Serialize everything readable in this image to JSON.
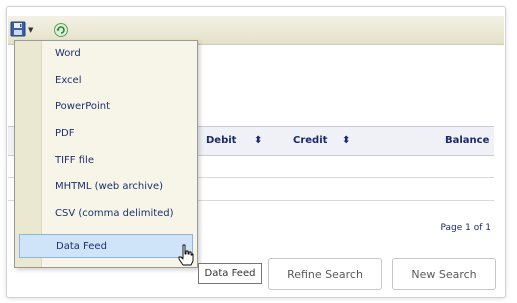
{
  "toolbar": {
    "export_icon": "save-disk-icon",
    "dropdown_icon": "chevron-down-icon",
    "refresh_icon": "refresh-icon"
  },
  "export_menu": {
    "items": [
      {
        "label": "Word"
      },
      {
        "label": "Excel"
      },
      {
        "label": "PowerPoint"
      },
      {
        "label": "PDF"
      },
      {
        "label": "TIFF file"
      },
      {
        "label": "MHTML (web archive)"
      },
      {
        "label": "CSV (comma delimited)"
      },
      {
        "label": "Data Feed"
      }
    ],
    "highlighted": "Data Feed"
  },
  "grid": {
    "columns": [
      {
        "label": "Debit",
        "sort_icon": "sort-arrows-icon"
      },
      {
        "label": "Credit",
        "sort_icon": "sort-arrows-icon"
      },
      {
        "label": "Balance"
      }
    ],
    "pager": "Page 1 of 1"
  },
  "tooltip": "Data Feed",
  "buttons": {
    "refine": "Refine Search",
    "new": "New Search"
  },
  "colors": {
    "menu_bg": "#f7f5e8",
    "highlight": "#cfe4f8",
    "text": "#1a2a6a"
  }
}
